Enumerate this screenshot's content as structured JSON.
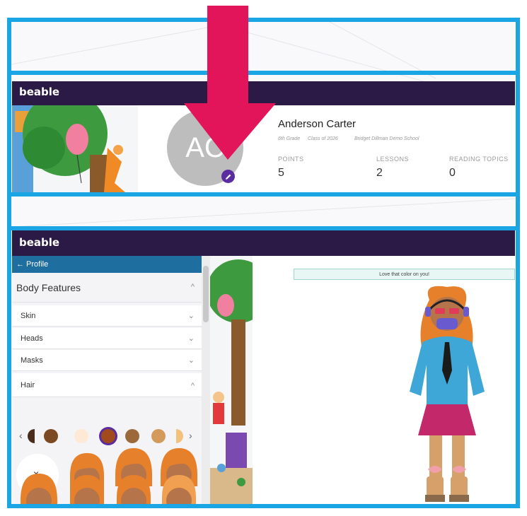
{
  "brand": {
    "logo_top": "beable",
    "logo_bottom": "beable"
  },
  "profile": {
    "name": "Anderson Carter",
    "avatar_initials": "AC",
    "grade": "6th Grade",
    "class_of": "Class of 2026",
    "school": "Bridget Dillman Demo School",
    "stats": [
      {
        "label": "POINTS",
        "value": "5"
      },
      {
        "label": "LESSONS",
        "value": "2"
      },
      {
        "label": "READING TOPICS",
        "value": "0"
      }
    ],
    "edit_icon": "pencil-icon"
  },
  "editor": {
    "back_label": "← Profile",
    "section_title": "Body Features",
    "categories": [
      {
        "label": "Skin",
        "chevron": "⌄"
      },
      {
        "label": "Heads",
        "chevron": "⌄"
      },
      {
        "label": "Masks",
        "chevron": "⌄"
      },
      {
        "label": "Hair",
        "chevron": "^"
      }
    ],
    "section_chevron": "^",
    "swatch_prev": "‹",
    "swatch_next": "›",
    "swatches": [
      "#4a2c1c",
      "#7b4a22",
      "#fde9d6",
      "#a14b1c",
      "#9c6a3a",
      "#d49a5b",
      "#f4c17a"
    ],
    "selected_swatch_index": 3,
    "none_label": "×",
    "message": "Love that color on you!"
  },
  "colors": {
    "frame": "#1aa6e4",
    "topbar": "#2b1a45",
    "arrow": "#e2145a",
    "accent": "#5a2ca0",
    "sidebar_header": "#1e6fa0"
  }
}
